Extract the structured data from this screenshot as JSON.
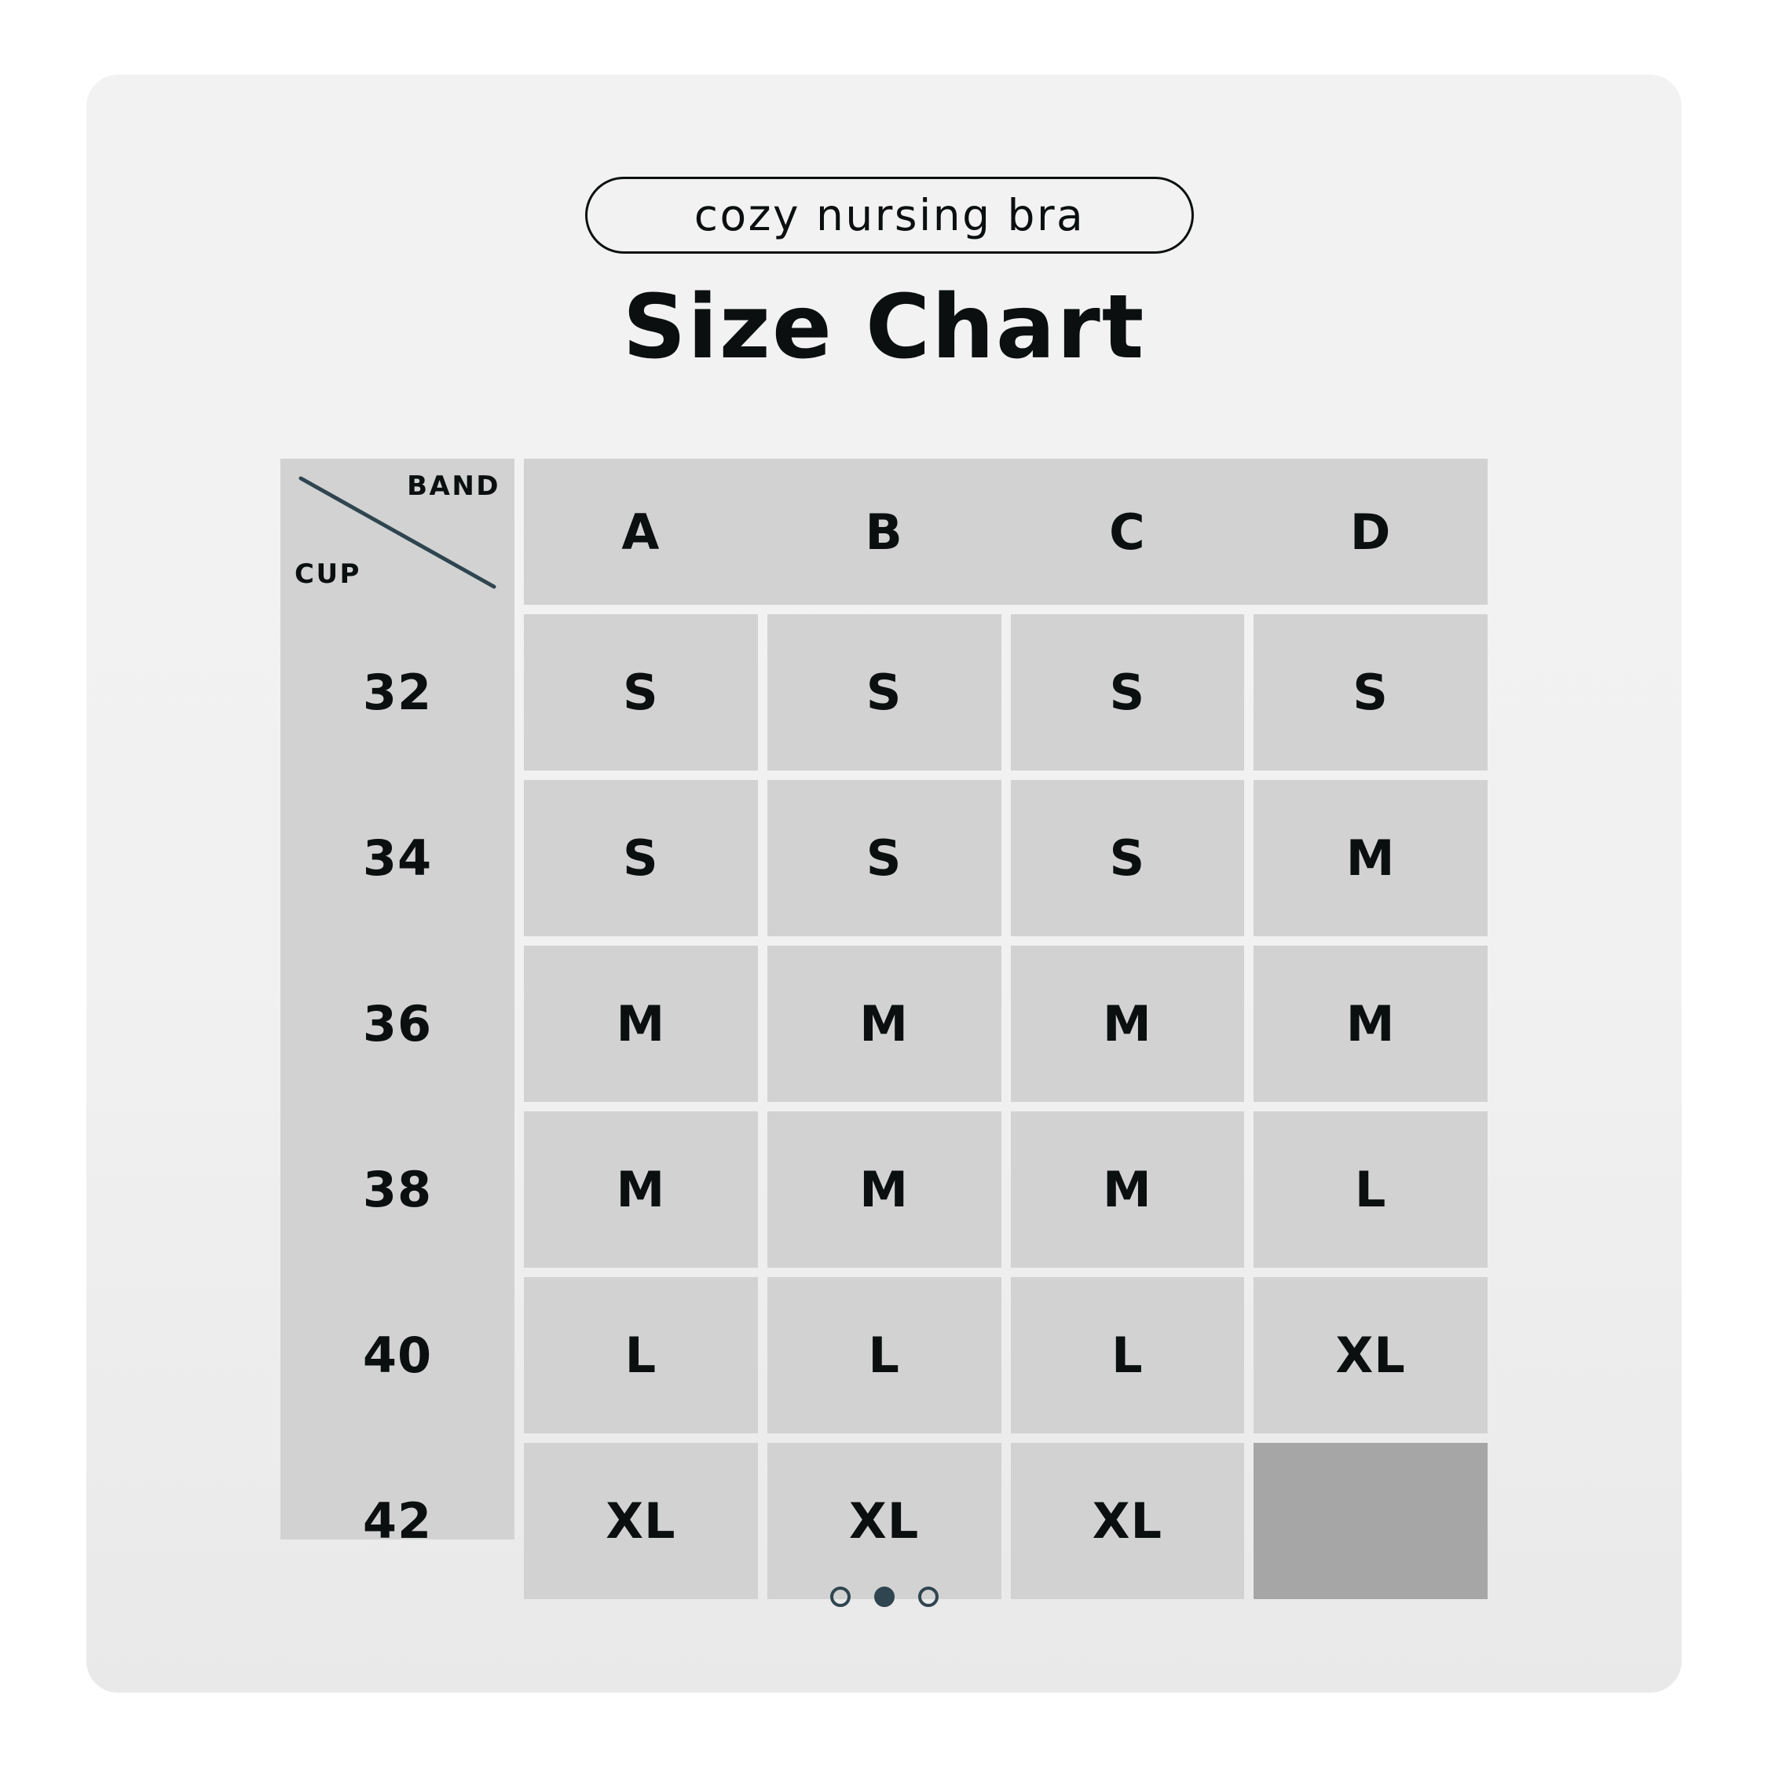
{
  "page": {
    "background_color": "#ffffff",
    "card_color": "#f1f1f1"
  },
  "badge": {
    "label": "cozy nursing bra"
  },
  "heading": {
    "title": "Size Chart"
  },
  "table": {
    "corner": {
      "top_right_label": "BAND",
      "bottom_left_label": "CUP",
      "diagonal_color": "#2f4550"
    },
    "cell_color": "#d2d2d2",
    "empty_cell_color": "#a6a6a6",
    "column_headers": [
      "A",
      "B",
      "C",
      "D"
    ],
    "row_headers": [
      "32",
      "34",
      "36",
      "38",
      "40",
      "42"
    ],
    "rows": [
      {
        "band": "32",
        "cells": [
          "S",
          "S",
          "S",
          "S"
        ]
      },
      {
        "band": "34",
        "cells": [
          "S",
          "S",
          "S",
          "M"
        ]
      },
      {
        "band": "36",
        "cells": [
          "M",
          "M",
          "M",
          "M"
        ]
      },
      {
        "band": "38",
        "cells": [
          "M",
          "M",
          "M",
          "L"
        ]
      },
      {
        "band": "40",
        "cells": [
          "L",
          "L",
          "L",
          "XL"
        ]
      },
      {
        "band": "42",
        "cells": [
          "XL",
          "XL",
          "XL",
          ""
        ]
      }
    ]
  },
  "pagination": {
    "total": 3,
    "active_index": 1,
    "dot_color": "#2f4550"
  }
}
